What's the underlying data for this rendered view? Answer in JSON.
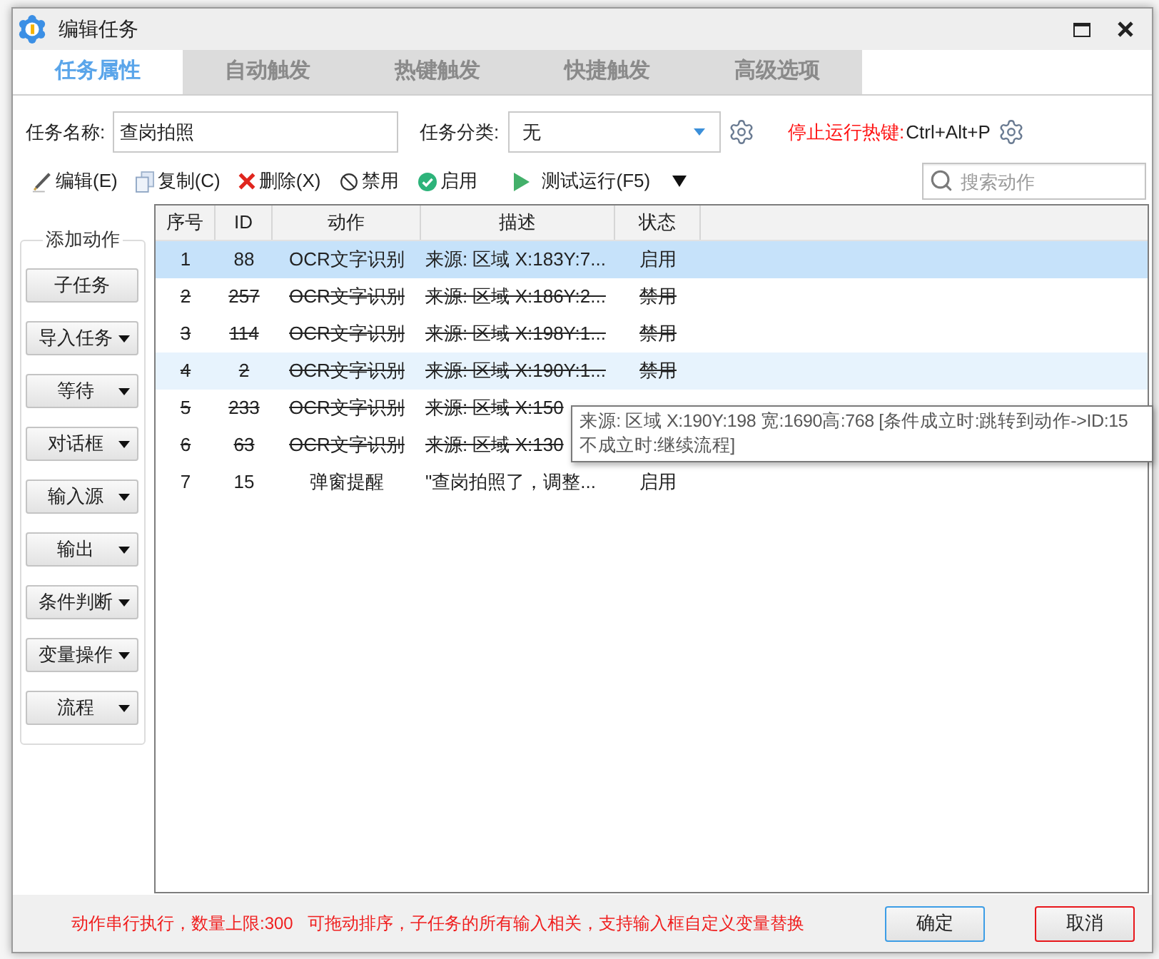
{
  "window": {
    "title": "编辑任务"
  },
  "tabs": [
    {
      "label": "任务属性",
      "selected": true
    },
    {
      "label": "自动触发",
      "selected": false
    },
    {
      "label": "热键触发",
      "selected": false
    },
    {
      "label": "快捷触发",
      "selected": false
    },
    {
      "label": "高级选项",
      "selected": false
    }
  ],
  "form": {
    "task_name": {
      "label": "任务名称:",
      "value": "查岗拍照"
    },
    "category": {
      "label": "任务分类:",
      "value": "无"
    },
    "stop_hotkey": {
      "label": "停止运行热键:",
      "value": "Ctrl+Alt+P"
    }
  },
  "toolbar": [
    {
      "kind": "edit",
      "label": "编辑(E)"
    },
    {
      "kind": "copy",
      "label": "复制(C)"
    },
    {
      "kind": "delete",
      "label": "删除(X)"
    },
    {
      "kind": "disable",
      "label": "禁用"
    },
    {
      "kind": "enable",
      "label": "启用"
    },
    {
      "kind": "run",
      "label": "测试运行(F5)"
    },
    {
      "kind": "menu"
    }
  ],
  "search": {
    "placeholder": "搜索动作"
  },
  "add_action_panel": {
    "title": "添加动作",
    "buttons": [
      {
        "label": "子任务",
        "dropdown": false
      },
      {
        "label": "导入任务",
        "dropdown": true
      },
      {
        "label": "等待",
        "dropdown": true
      },
      {
        "label": "对话框",
        "dropdown": true
      },
      {
        "label": "输入源",
        "dropdown": true
      },
      {
        "label": "输出",
        "dropdown": true
      },
      {
        "label": "条件判断",
        "dropdown": true
      },
      {
        "label": "变量操作",
        "dropdown": true
      },
      {
        "label": "流程",
        "dropdown": true
      }
    ]
  },
  "table": {
    "columns": [
      "序号",
      "ID",
      "动作",
      "描述",
      "状态"
    ],
    "rows": [
      {
        "cells": [
          "1",
          "88",
          "OCR文字识别",
          "来源: 区域 X:183Y:7...",
          "启用"
        ],
        "enabled": true,
        "selected": true,
        "hovered": false
      },
      {
        "cells": [
          "2",
          "257",
          "OCR文字识别",
          "来源: 区域 X:186Y:2...",
          "禁用"
        ],
        "enabled": false,
        "selected": false,
        "hovered": false
      },
      {
        "cells": [
          "3",
          "114",
          "OCR文字识别",
          "来源: 区域 X:198Y:1...",
          "禁用"
        ],
        "enabled": false,
        "selected": false,
        "hovered": false
      },
      {
        "cells": [
          "4",
          "2",
          "OCR文字识别",
          "来源: 区域 X:190Y:1...",
          "禁用"
        ],
        "enabled": false,
        "selected": false,
        "hovered": true
      },
      {
        "cells": [
          "5",
          "233",
          "OCR文字识别",
          "来源: 区域 X:150"
        ],
        "enabled": false,
        "selected": false,
        "hovered": false
      },
      {
        "cells": [
          "6",
          "63",
          "OCR文字识别",
          "来源: 区域 X:130"
        ],
        "enabled": false,
        "selected": false,
        "hovered": false
      },
      {
        "cells": [
          "7",
          "15",
          "弹窗提醒",
          "\"查岗拍照了，调整...",
          "启用"
        ],
        "enabled": true,
        "selected": false,
        "hovered": false
      }
    ]
  },
  "tooltip": {
    "text": "来源: 区域 X:190Y:198 宽:1690高:768 [条件成立时:跳转到动作->ID:15 不成立时:继续流程]"
  },
  "status_bar": {
    "note": "动作串行执行，数量上限:300   可拖动排序，子任务的所有输入相关，支持输入框自定义变量替换",
    "buttons": [
      {
        "label": "确定",
        "color": "#3c9de6"
      },
      {
        "label": "取消",
        "color": "#e8161b"
      }
    ]
  }
}
